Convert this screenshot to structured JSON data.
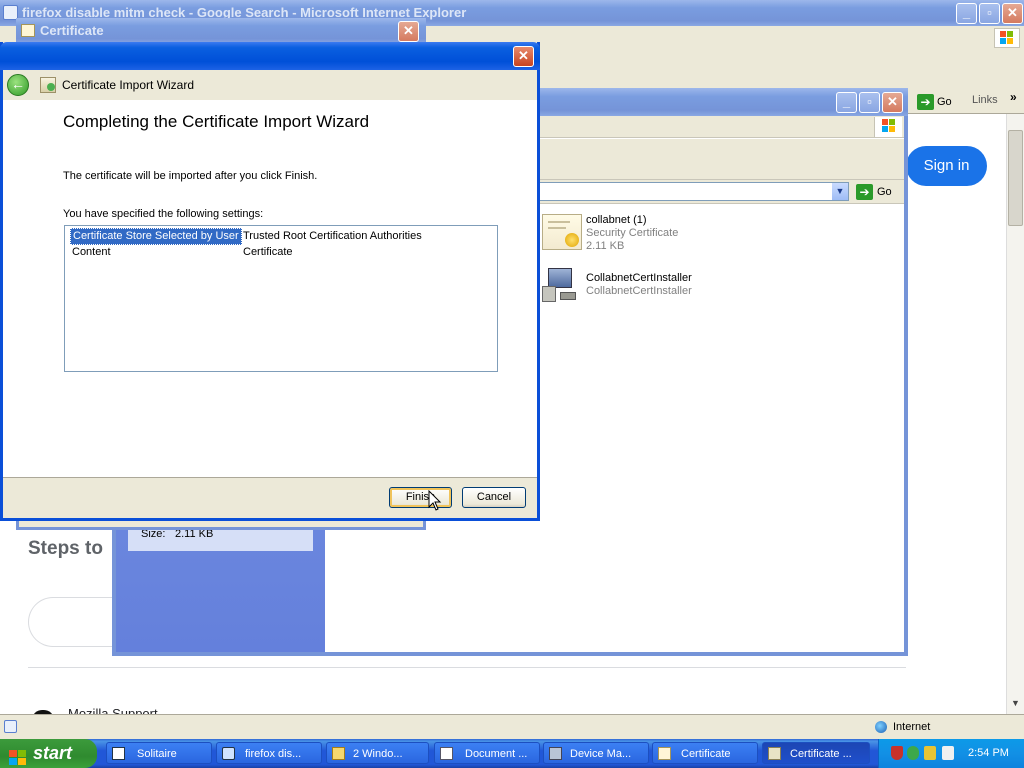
{
  "ie": {
    "title": "firefox disable mitm check - Google Search - Microsoft Internet Explorer",
    "go_label": "Go",
    "links_label": "Links",
    "sign_in_label": "Sign in",
    "steps_heading": "Steps to",
    "support_text": "Mozilla Support",
    "status_zone": "Internet"
  },
  "cert_window": {
    "title": "Certificate",
    "size_label": "Size:",
    "size_value": "2.11 KB"
  },
  "explorer": {
    "go_label": "Go",
    "files": [
      {
        "name": "collabnet (1)",
        "type": "Security Certificate",
        "size": "2.11 KB"
      },
      {
        "name": "CollabnetCertInstaller",
        "type": "CollabnetCertInstaller"
      }
    ]
  },
  "wizard": {
    "header_title": "Certificate Import Wizard",
    "heading": "Completing the Certificate Import Wizard",
    "intro": "The certificate will be imported after you click Finish.",
    "settings_label": "You have specified the following settings:",
    "settings": [
      {
        "key": "Certificate Store Selected by User",
        "value": "Trusted Root Certification Authorities"
      },
      {
        "key": "Content",
        "value": "Certificate"
      }
    ],
    "finish_label": "Finish",
    "cancel_label": "Cancel"
  },
  "taskbar": {
    "start_label": "start",
    "tasks": [
      {
        "label": "Solitaire"
      },
      {
        "label": "firefox dis..."
      },
      {
        "label": "2 Windo..."
      },
      {
        "label": "Document ..."
      },
      {
        "label": "Device Ma..."
      },
      {
        "label": "Certificate"
      },
      {
        "label": "Certificate ..."
      }
    ],
    "clock": "2:54 PM"
  },
  "colors": {
    "xp_blue": "#0050d8",
    "selection": "#316ac5",
    "start_green": "#2f8a2f"
  }
}
